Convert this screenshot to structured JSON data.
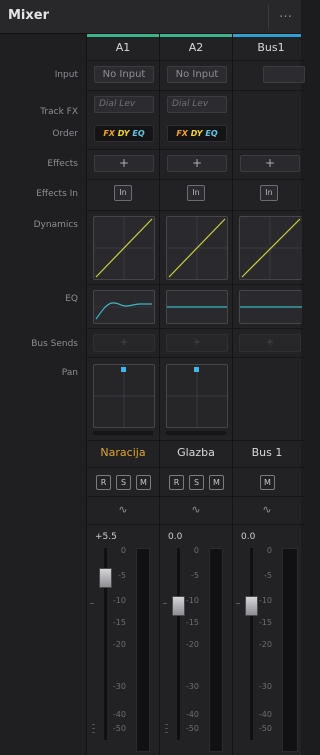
{
  "panel": {
    "title": "Mixer",
    "more_label": "…"
  },
  "labels": {
    "input": "Input",
    "track_fx": "Track FX",
    "order": "Order",
    "effects": "Effects",
    "effects_in": "Effects In",
    "dynamics": "Dynamics",
    "eq": "EQ",
    "bus_sends": "Bus Sends",
    "pan": "Pan"
  },
  "strips": [
    {
      "channel": "A1",
      "input": "No Input",
      "track_fx": "Dial Lev",
      "effects": "+",
      "effects_in": "In",
      "track_name": "Naracija",
      "buttons": [
        "R",
        "S",
        "M"
      ],
      "gain": "+5.5",
      "bus_send": "+"
    },
    {
      "channel": "A2",
      "input": "No Input",
      "track_fx": "Dial Lev",
      "effects": "+",
      "effects_in": "In",
      "track_name": "Glazba",
      "buttons": [
        "R",
        "S",
        "M"
      ],
      "gain": "0.0",
      "bus_send": "+"
    },
    {
      "channel": "Bus1",
      "input": "",
      "track_fx": "",
      "effects": "+",
      "effects_in": "In",
      "track_name": "Bus 1",
      "buttons": [
        "M"
      ],
      "gain": "0.0",
      "bus_send": "+"
    }
  ],
  "order_labels": {
    "fx": "FX",
    "dy": "DY",
    "eq": "EQ"
  },
  "automation_icon": "∿",
  "meter_scale": [
    "0",
    "-5",
    "-10",
    "-15",
    "-20",
    "-30",
    "-40",
    "-50"
  ],
  "colors": {
    "a_channel": "#3cb489",
    "bus_channel": "#2f9fd4",
    "track_named": "#e0a32e",
    "pan_dot": "#42b5ee",
    "curve": "#c8d23a",
    "eq_line": "#3fb8c4"
  }
}
